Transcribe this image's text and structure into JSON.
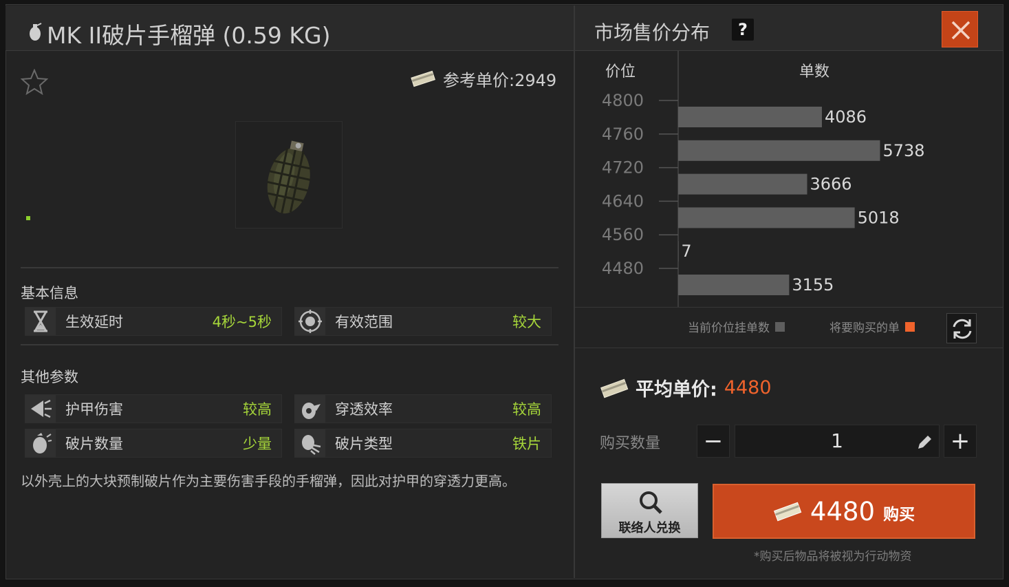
{
  "header": {
    "title": "MK II破片手榴弹 (0.59 KG)",
    "market_title": "市场售价分布",
    "help_label": "?"
  },
  "item": {
    "ref_price": "参考单价:2949",
    "icons": {
      "favorite": "star-icon",
      "money": "money-icon",
      "item": "grenade-icon"
    }
  },
  "basic_info": {
    "section_label": "基本信息",
    "stats": [
      {
        "label": "生效延时",
        "value": "4秒~5秒",
        "icon": "hourglass-icon"
      },
      {
        "label": "有效范围",
        "value": "较大",
        "icon": "target-icon"
      }
    ]
  },
  "other_params": {
    "section_label": "其他参数",
    "stats": [
      {
        "label": "护甲伤害",
        "value": "较高",
        "icon": "armor-damage-icon"
      },
      {
        "label": "穿透效率",
        "value": "较高",
        "icon": "penetration-icon"
      },
      {
        "label": "破片数量",
        "value": "少量",
        "icon": "fragment-count-icon"
      },
      {
        "label": "破片类型",
        "value": "铁片",
        "icon": "fragment-type-icon"
      }
    ]
  },
  "description": "以外壳上的大块预制破片作为主要伤害手段的手榴弹，因此对护甲的穿透力更高。",
  "chart_data": {
    "type": "bar",
    "orientation": "horizontal",
    "xlabel": "单数",
    "ylabel": "价位",
    "y_ticks": [
      "4800",
      "4760",
      "4720",
      "4640",
      "4560",
      "4480"
    ],
    "values": [
      4086,
      5738,
      3666,
      5018,
      7,
      3155
    ],
    "bar_color": "#5e5e5e",
    "legend": [
      {
        "label": "当前价位挂单数",
        "color": "#5e5e5e"
      },
      {
        "label": "将要购买的单",
        "color": "#f0632c"
      }
    ]
  },
  "purchase": {
    "avg_label": "平均单价:",
    "avg_value": "4480",
    "qty_label": "购买数量",
    "qty_value": "1",
    "minus": "−",
    "plus": "+",
    "contact_label": "联络人兑换",
    "buy_amount": "4480",
    "buy_label": "购买",
    "note": "*购买后物品将被视为行动物资"
  },
  "colors": {
    "accent": "#f0632c",
    "value_green": "#a6d63a",
    "buy_button": "#c9481d"
  }
}
